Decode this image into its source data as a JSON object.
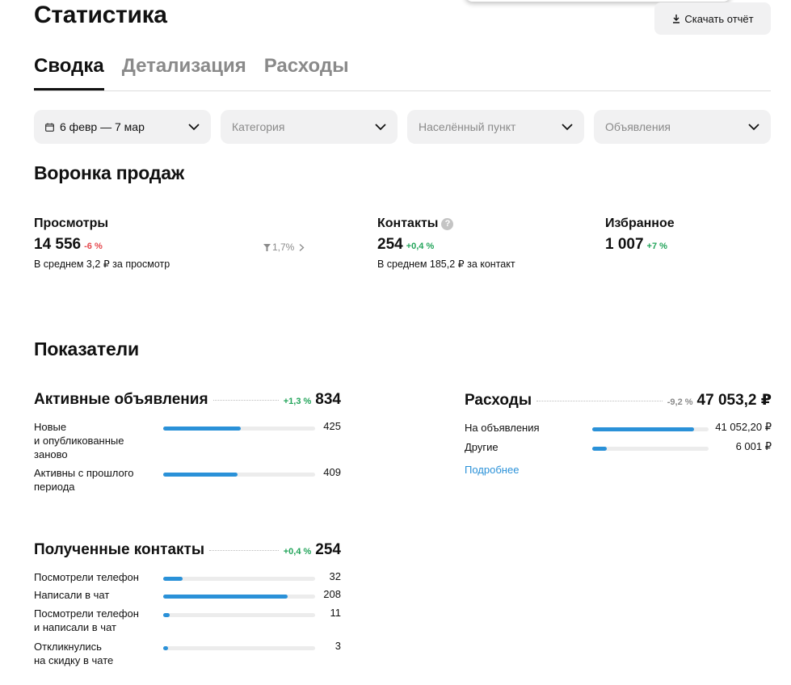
{
  "header": {
    "title": "Статистика",
    "download_label": "Скачать отчёт",
    "download_icon": "download-icon"
  },
  "tabs": [
    {
      "label": "Сводка",
      "active": true
    },
    {
      "label": "Детализация",
      "active": false
    },
    {
      "label": "Расходы",
      "active": false
    }
  ],
  "filters": {
    "date": "6 февр — 7 мар",
    "category": "Категория",
    "city": "Населённый пункт",
    "ads": "Объявления"
  },
  "funnel": {
    "title": "Воронка продаж",
    "views": {
      "label": "Просмотры",
      "value": "14 556",
      "delta": "-6 %",
      "sub": "В среднем 3,2 ₽ за просмотр"
    },
    "conversion": "1,7%",
    "contacts": {
      "label": "Контакты",
      "value": "254",
      "delta": "+0,4 %",
      "sub": "В среднем 185,2 ₽ за контакт",
      "help": "?"
    },
    "favorites": {
      "label": "Избранное",
      "value": "1 007",
      "delta": "+7 %"
    }
  },
  "indicators": {
    "title": "Показатели",
    "active_ads": {
      "title": "Активные объявления",
      "delta": "+1,3 %",
      "total": "834",
      "rows": [
        {
          "label": "Новые\nи опубликованные\nзаново",
          "value": "425",
          "share": 0.51
        },
        {
          "label": "Активны с прошлого\nпериода",
          "value": "409",
          "share": 0.49
        }
      ]
    },
    "contacts": {
      "title": "Полученные контакты",
      "delta": "+0,4 %",
      "total": "254",
      "rows": [
        {
          "label": "Посмотрели телефон",
          "value": "32",
          "share": 0.126
        },
        {
          "label": "Написали в чат",
          "value": "208",
          "share": 0.819
        },
        {
          "label": "Посмотрели телефон\nи написали в чат",
          "value": "11",
          "share": 0.043
        },
        {
          "label": "Откликнулись\nна скидку в чате",
          "value": "3",
          "share": 0.012
        }
      ]
    },
    "expenses": {
      "title": "Расходы",
      "delta": "-9,2 %",
      "total": "47 053,2 ₽",
      "rows": [
        {
          "label": "На объявления",
          "value": "41 052,20 ₽",
          "share": 0.872
        },
        {
          "label": "Другие",
          "value": "6 001 ₽",
          "share": 0.128
        }
      ],
      "more_label": "Подробнее"
    }
  },
  "colors": {
    "accent": "#2a91d8",
    "positive": "#22a45a",
    "negative": "#e5484d",
    "muted": "#8a8a8a",
    "surface": "#f1f1f2"
  }
}
